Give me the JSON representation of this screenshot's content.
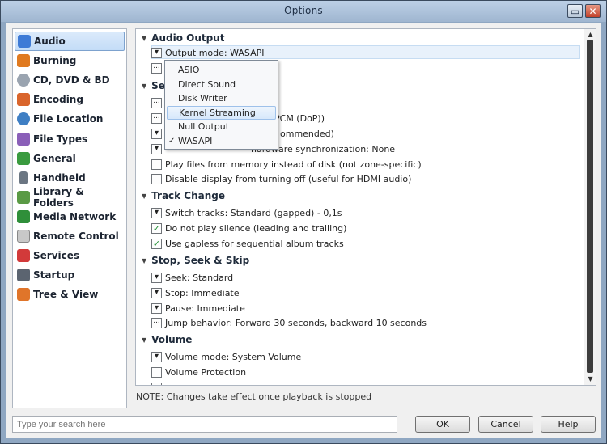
{
  "window": {
    "title": "Options"
  },
  "titlebar": {
    "maximize_glyph": "▭",
    "close_glyph": "✕"
  },
  "sidebar": {
    "items": [
      {
        "label": "Audio",
        "icon": "audio-icon",
        "color": "#3e7bd6",
        "selected": true
      },
      {
        "label": "Burning",
        "icon": "burning-icon",
        "color": "#e07a1f"
      },
      {
        "label": "CD, DVD & BD",
        "icon": "disc-icon",
        "color": "#9aa4b0"
      },
      {
        "label": "Encoding",
        "icon": "encoding-icon",
        "color": "#d9652c"
      },
      {
        "label": "File Location",
        "icon": "file-location-icon",
        "color": "#3f7fc4"
      },
      {
        "label": "File Types",
        "icon": "file-types-icon",
        "color": "#8a5fb8"
      },
      {
        "label": "General",
        "icon": "general-icon",
        "color": "#3a9b3f"
      },
      {
        "label": "Handheld",
        "icon": "handheld-icon",
        "color": "#6b7682"
      },
      {
        "label": "Library & Folders",
        "icon": "library-icon",
        "color": "#5a9a45"
      },
      {
        "label": "Media Network",
        "icon": "network-icon",
        "color": "#2f8f3a"
      },
      {
        "label": "Remote Control",
        "icon": "remote-icon",
        "color": "#c8c8c8"
      },
      {
        "label": "Services",
        "icon": "services-icon",
        "color": "#d23a3a"
      },
      {
        "label": "Startup",
        "icon": "startup-icon",
        "color": "#5b6470"
      },
      {
        "label": "Tree & View",
        "icon": "tree-icon",
        "color": "#e0752a"
      }
    ]
  },
  "panel": {
    "sections": {
      "audio_output": "Audio Output",
      "settings_partial": "Se",
      "track_change": "Track Change",
      "stop_seek_skip": "Stop, Seek & Skip",
      "volume": "Volume"
    },
    "rows": {
      "output_mode": "Output mode: WASAPI",
      "dsd_partial": "PCM (DoP))",
      "recommended_partial": "ommended)",
      "play_silence_partial": "nardware synchronization: None",
      "play_from_memory": "Play files from memory instead of disk (not zone-specific)",
      "disable_display": "Disable display from turning off (useful for HDMI audio)",
      "switch_tracks": "Switch tracks: Standard (gapped) - 0,1s",
      "no_silence": "Do not play silence (leading and trailing)",
      "gapless": "Use gapless for sequential album tracks",
      "seek": "Seek: Standard",
      "stop": "Stop: Immediate",
      "pause": "Pause: Immediate",
      "jump": "Jump behavior: Forward 30 seconds, backward 10 seconds",
      "volume_mode": "Volume mode: System Volume",
      "volume_protection": "Volume Protection"
    },
    "checked": {
      "play_from_memory": false,
      "disable_display": false,
      "no_silence": true,
      "gapless": true,
      "volume_protection": false
    }
  },
  "output_menu": {
    "items": [
      {
        "label": "ASIO"
      },
      {
        "label": "Direct Sound"
      },
      {
        "label": "Disk Writer"
      },
      {
        "label": "Kernel Streaming",
        "hover": true
      },
      {
        "label": "Null Output"
      },
      {
        "label": "WASAPI",
        "checked": true
      }
    ],
    "check_glyph": "✓"
  },
  "footer": {
    "note": "NOTE: Changes take effect once playback is stopped",
    "search_placeholder": "Type your search here",
    "ok": "OK",
    "cancel": "Cancel",
    "help": "Help"
  }
}
